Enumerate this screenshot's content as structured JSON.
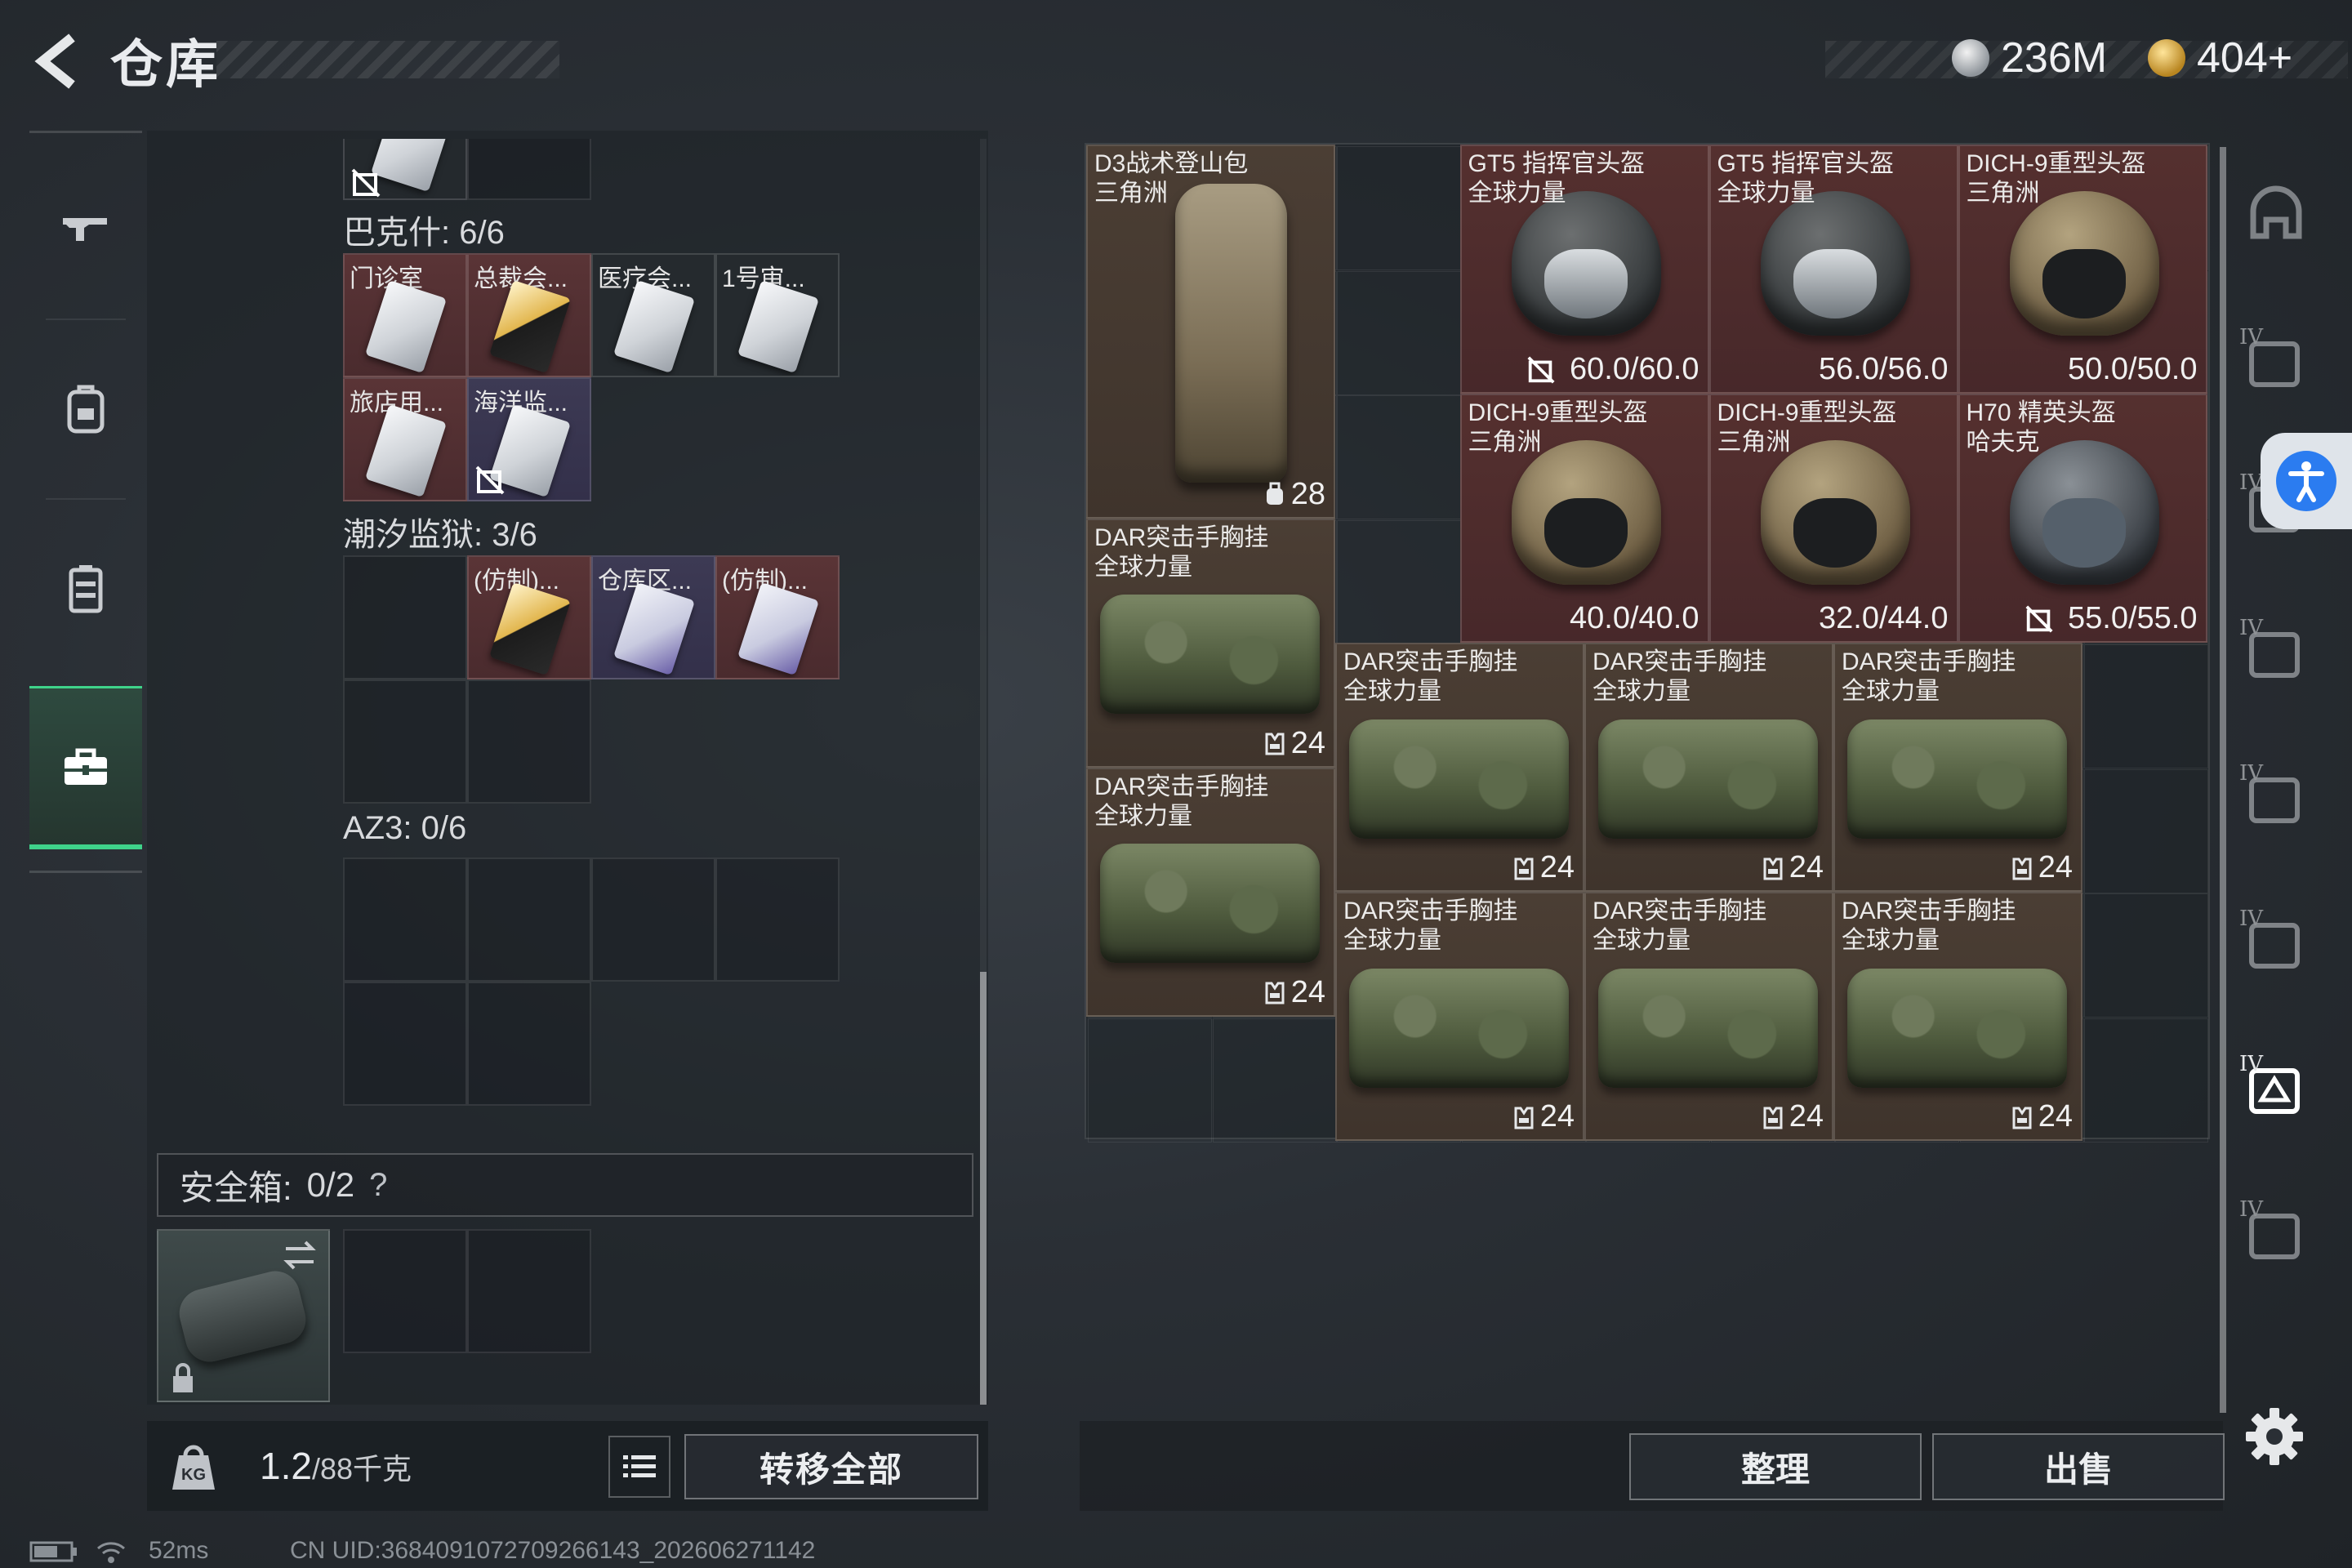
{
  "header": {
    "title": "仓库",
    "currencies": [
      {
        "icon": "silver-coin-icon",
        "value": "236M"
      },
      {
        "icon": "gold-coin-icon",
        "value": "404+"
      }
    ]
  },
  "nav": [
    {
      "icon": "rifle-icon",
      "active": false
    },
    {
      "icon": "backpack-icon",
      "active": false
    },
    {
      "icon": "vest-icon",
      "active": false
    },
    {
      "icon": "toolbox-icon",
      "active": true
    }
  ],
  "containers": {
    "sections": [
      {
        "label": "巴克什: 6/6"
      },
      {
        "label": "潮汐监狱: 3/6"
      },
      {
        "label": "AZ3: 0/6"
      }
    ],
    "keys": [
      {
        "name": "门诊室",
        "bg": "red",
        "card": "white",
        "nosell": false
      },
      {
        "name": "总裁会...",
        "bg": "red",
        "card": "gold",
        "nosell": false
      },
      {
        "name": "医疗会...",
        "bg": "plain",
        "card": "white",
        "nosell": false
      },
      {
        "name": "1号审...",
        "bg": "plain",
        "card": "white",
        "nosell": false
      },
      {
        "name": "旅店用...",
        "bg": "red",
        "card": "white",
        "nosell": false
      },
      {
        "name": "海洋监...",
        "bg": "purple",
        "card": "white",
        "nosell": true
      },
      {
        "name": "(仿制)...",
        "bg": "red",
        "card": "gold",
        "nosell": false
      },
      {
        "name": "仓库区...",
        "bg": "purple",
        "card": "violet",
        "nosell": false
      },
      {
        "name": "(仿制)...",
        "bg": "red",
        "card": "violet",
        "nosell": false
      }
    ],
    "safe_box": {
      "label": "安全箱:",
      "count": "0/2",
      "help": "?"
    }
  },
  "footer_left": {
    "weight": "1.2",
    "weight_max": "/88千克",
    "transfer_all": "转移全部"
  },
  "status": {
    "ping": "52ms",
    "uid": "CN UID:3684091072709266143_202606271142"
  },
  "stash_items": [
    {
      "name1": "D3战术登山包",
      "name2": "三角洲",
      "value": "28",
      "value_icon": "capacity-icon"
    },
    {
      "name1": "GT5 指挥官头盔",
      "name2": "全球力量",
      "value": "60.0/60.0",
      "nosell": true
    },
    {
      "name1": "GT5 指挥官头盔",
      "name2": "全球力量",
      "value": "56.0/56.0"
    },
    {
      "name1": "DICH-9重型头盔",
      "name2": "三角洲",
      "value": "50.0/50.0"
    },
    {
      "name1": "DICH-9重型头盔",
      "name2": "三角洲",
      "value": "40.0/40.0"
    },
    {
      "name1": "DICH-9重型头盔",
      "name2": "三角洲",
      "value": "32.0/44.0"
    },
    {
      "name1": "H70 精英头盔",
      "name2": "哈夫克",
      "value": "55.0/55.0",
      "nosell": true
    },
    {
      "name1": "DAR突击手胸挂",
      "name2": "全球力量",
      "value": "24"
    },
    {
      "name1": "DAR突击手胸挂",
      "name2": "全球力量",
      "value": "24"
    },
    {
      "name1": "DAR突击手胸挂",
      "name2": "全球力量",
      "value": "24"
    },
    {
      "name1": "DAR突击手胸挂",
      "name2": "全球力量",
      "value": "24"
    },
    {
      "name1": "DAR突击手胸挂",
      "name2": "全球力量",
      "value": "24"
    },
    {
      "name1": "DAR突击手胸挂",
      "name2": "全球力量",
      "value": "24"
    },
    {
      "name1": "DAR突击手胸挂",
      "name2": "全球力量",
      "value": "24"
    },
    {
      "name1": "DAR突击手胸挂",
      "name2": "全球力量",
      "value": "24"
    }
  ],
  "filters": [
    {
      "icon": "helmet-filter-icon",
      "tier": ""
    },
    {
      "icon": "armor-filter-icon",
      "tier": "IV"
    },
    {
      "icon": "rig-filter-icon",
      "tier": "IV"
    },
    {
      "icon": "ammo-filter-icon",
      "tier": "IV"
    },
    {
      "icon": "folder-filter-icon",
      "tier": "IV"
    },
    {
      "icon": "weapon-filter-icon",
      "tier": "IV"
    },
    {
      "icon": "key-filter-icon",
      "tier": "IV"
    },
    {
      "icon": "misc-filter-icon",
      "tier": "IV"
    }
  ],
  "footer_right": {
    "sort": "整理",
    "sell": "出售"
  },
  "colors": {
    "accent_green": "#3fd38a",
    "rarity_red": "#55302f",
    "rarity_brown": "#4b3e34",
    "rarity_purple": "#3d3a54"
  }
}
